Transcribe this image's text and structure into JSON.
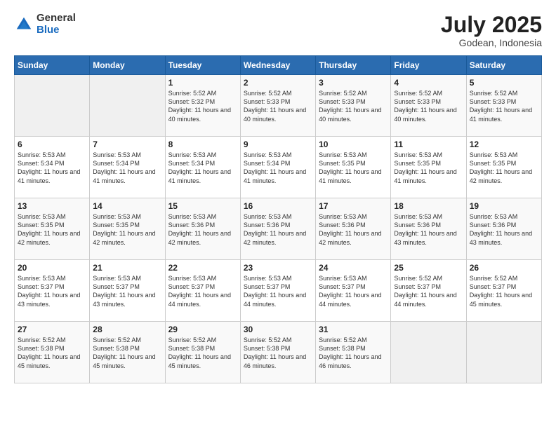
{
  "logo": {
    "general": "General",
    "blue": "Blue"
  },
  "header": {
    "month": "July 2025",
    "location": "Godean, Indonesia"
  },
  "weekdays": [
    "Sunday",
    "Monday",
    "Tuesday",
    "Wednesday",
    "Thursday",
    "Friday",
    "Saturday"
  ],
  "weeks": [
    [
      {
        "day": "",
        "empty": true
      },
      {
        "day": "",
        "empty": true
      },
      {
        "day": "1",
        "sunrise": "Sunrise: 5:52 AM",
        "sunset": "Sunset: 5:32 PM",
        "daylight": "Daylight: 11 hours and 40 minutes."
      },
      {
        "day": "2",
        "sunrise": "Sunrise: 5:52 AM",
        "sunset": "Sunset: 5:33 PM",
        "daylight": "Daylight: 11 hours and 40 minutes."
      },
      {
        "day": "3",
        "sunrise": "Sunrise: 5:52 AM",
        "sunset": "Sunset: 5:33 PM",
        "daylight": "Daylight: 11 hours and 40 minutes."
      },
      {
        "day": "4",
        "sunrise": "Sunrise: 5:52 AM",
        "sunset": "Sunset: 5:33 PM",
        "daylight": "Daylight: 11 hours and 40 minutes."
      },
      {
        "day": "5",
        "sunrise": "Sunrise: 5:52 AM",
        "sunset": "Sunset: 5:33 PM",
        "daylight": "Daylight: 11 hours and 41 minutes."
      }
    ],
    [
      {
        "day": "6",
        "sunrise": "Sunrise: 5:53 AM",
        "sunset": "Sunset: 5:34 PM",
        "daylight": "Daylight: 11 hours and 41 minutes."
      },
      {
        "day": "7",
        "sunrise": "Sunrise: 5:53 AM",
        "sunset": "Sunset: 5:34 PM",
        "daylight": "Daylight: 11 hours and 41 minutes."
      },
      {
        "day": "8",
        "sunrise": "Sunrise: 5:53 AM",
        "sunset": "Sunset: 5:34 PM",
        "daylight": "Daylight: 11 hours and 41 minutes."
      },
      {
        "day": "9",
        "sunrise": "Sunrise: 5:53 AM",
        "sunset": "Sunset: 5:34 PM",
        "daylight": "Daylight: 11 hours and 41 minutes."
      },
      {
        "day": "10",
        "sunrise": "Sunrise: 5:53 AM",
        "sunset": "Sunset: 5:35 PM",
        "daylight": "Daylight: 11 hours and 41 minutes."
      },
      {
        "day": "11",
        "sunrise": "Sunrise: 5:53 AM",
        "sunset": "Sunset: 5:35 PM",
        "daylight": "Daylight: 11 hours and 41 minutes."
      },
      {
        "day": "12",
        "sunrise": "Sunrise: 5:53 AM",
        "sunset": "Sunset: 5:35 PM",
        "daylight": "Daylight: 11 hours and 42 minutes."
      }
    ],
    [
      {
        "day": "13",
        "sunrise": "Sunrise: 5:53 AM",
        "sunset": "Sunset: 5:35 PM",
        "daylight": "Daylight: 11 hours and 42 minutes."
      },
      {
        "day": "14",
        "sunrise": "Sunrise: 5:53 AM",
        "sunset": "Sunset: 5:35 PM",
        "daylight": "Daylight: 11 hours and 42 minutes."
      },
      {
        "day": "15",
        "sunrise": "Sunrise: 5:53 AM",
        "sunset": "Sunset: 5:36 PM",
        "daylight": "Daylight: 11 hours and 42 minutes."
      },
      {
        "day": "16",
        "sunrise": "Sunrise: 5:53 AM",
        "sunset": "Sunset: 5:36 PM",
        "daylight": "Daylight: 11 hours and 42 minutes."
      },
      {
        "day": "17",
        "sunrise": "Sunrise: 5:53 AM",
        "sunset": "Sunset: 5:36 PM",
        "daylight": "Daylight: 11 hours and 42 minutes."
      },
      {
        "day": "18",
        "sunrise": "Sunrise: 5:53 AM",
        "sunset": "Sunset: 5:36 PM",
        "daylight": "Daylight: 11 hours and 43 minutes."
      },
      {
        "day": "19",
        "sunrise": "Sunrise: 5:53 AM",
        "sunset": "Sunset: 5:36 PM",
        "daylight": "Daylight: 11 hours and 43 minutes."
      }
    ],
    [
      {
        "day": "20",
        "sunrise": "Sunrise: 5:53 AM",
        "sunset": "Sunset: 5:37 PM",
        "daylight": "Daylight: 11 hours and 43 minutes."
      },
      {
        "day": "21",
        "sunrise": "Sunrise: 5:53 AM",
        "sunset": "Sunset: 5:37 PM",
        "daylight": "Daylight: 11 hours and 43 minutes."
      },
      {
        "day": "22",
        "sunrise": "Sunrise: 5:53 AM",
        "sunset": "Sunset: 5:37 PM",
        "daylight": "Daylight: 11 hours and 44 minutes."
      },
      {
        "day": "23",
        "sunrise": "Sunrise: 5:53 AM",
        "sunset": "Sunset: 5:37 PM",
        "daylight": "Daylight: 11 hours and 44 minutes."
      },
      {
        "day": "24",
        "sunrise": "Sunrise: 5:53 AM",
        "sunset": "Sunset: 5:37 PM",
        "daylight": "Daylight: 11 hours and 44 minutes."
      },
      {
        "day": "25",
        "sunrise": "Sunrise: 5:52 AM",
        "sunset": "Sunset: 5:37 PM",
        "daylight": "Daylight: 11 hours and 44 minutes."
      },
      {
        "day": "26",
        "sunrise": "Sunrise: 5:52 AM",
        "sunset": "Sunset: 5:37 PM",
        "daylight": "Daylight: 11 hours and 45 minutes."
      }
    ],
    [
      {
        "day": "27",
        "sunrise": "Sunrise: 5:52 AM",
        "sunset": "Sunset: 5:38 PM",
        "daylight": "Daylight: 11 hours and 45 minutes."
      },
      {
        "day": "28",
        "sunrise": "Sunrise: 5:52 AM",
        "sunset": "Sunset: 5:38 PM",
        "daylight": "Daylight: 11 hours and 45 minutes."
      },
      {
        "day": "29",
        "sunrise": "Sunrise: 5:52 AM",
        "sunset": "Sunset: 5:38 PM",
        "daylight": "Daylight: 11 hours and 45 minutes."
      },
      {
        "day": "30",
        "sunrise": "Sunrise: 5:52 AM",
        "sunset": "Sunset: 5:38 PM",
        "daylight": "Daylight: 11 hours and 46 minutes."
      },
      {
        "day": "31",
        "sunrise": "Sunrise: 5:52 AM",
        "sunset": "Sunset: 5:38 PM",
        "daylight": "Daylight: 11 hours and 46 minutes."
      },
      {
        "day": "",
        "empty": true
      },
      {
        "day": "",
        "empty": true
      }
    ]
  ]
}
